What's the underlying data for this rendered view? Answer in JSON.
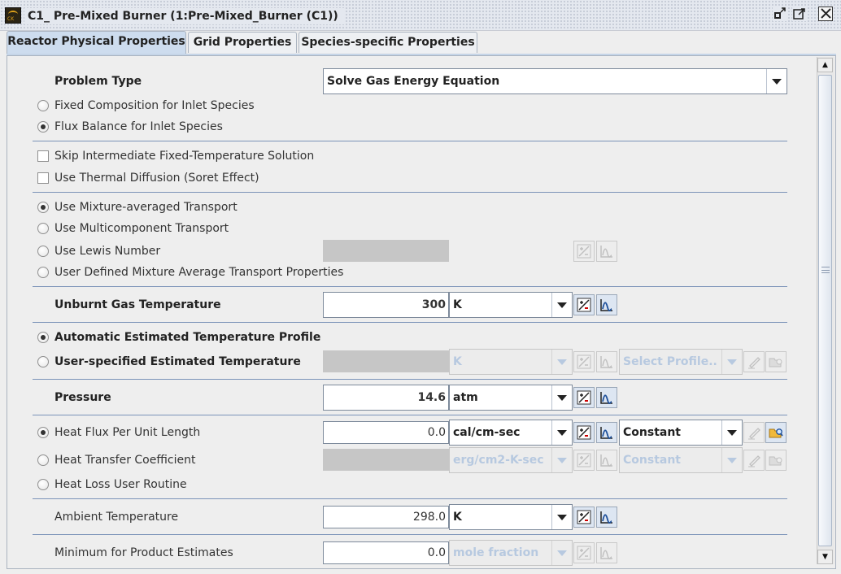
{
  "window": {
    "title": "C1_ Pre-Mixed Burner  (1:Pre-Mixed_Burner (C1))",
    "buttons": [
      "restore",
      "maximize",
      "close"
    ]
  },
  "tabs": [
    {
      "label": "Reactor Physical Properties",
      "active": true
    },
    {
      "label": "Grid Properties",
      "active": false
    },
    {
      "label": "Species-specific Properties",
      "active": false
    }
  ],
  "problem_type": {
    "label": "Problem Type",
    "value": "Solve Gas Energy Equation",
    "options": [
      {
        "label": "Fixed Composition for Inlet Species",
        "selected": false
      },
      {
        "label": "Flux Balance for Inlet Species",
        "selected": true
      }
    ]
  },
  "checkboxes": [
    {
      "label": "Skip Intermediate Fixed-Temperature Solution",
      "checked": false
    },
    {
      "label": "Use Thermal Diffusion (Soret Effect)",
      "checked": false
    }
  ],
  "transport": [
    {
      "label": "Use Mixture-averaged Transport",
      "selected": true
    },
    {
      "label": "Use Multicomponent Transport",
      "selected": false
    },
    {
      "label": "Use Lewis Number",
      "selected": false
    },
    {
      "label": "User Defined Mixture Average Transport Properties",
      "selected": false
    }
  ],
  "unburnt_gas": {
    "label": "Unburnt Gas Temperature",
    "value": "300",
    "unit": "K"
  },
  "temperature_profile": [
    {
      "label": "Automatic Estimated Temperature Profile",
      "selected": true
    },
    {
      "label": "User-specified Estimated Temperature",
      "selected": false,
      "unit": "K",
      "profile": "Select Profile.."
    }
  ],
  "pressure": {
    "label": "Pressure",
    "value": "14.6",
    "unit": "atm"
  },
  "heat_loss": [
    {
      "label": "Heat Flux Per Unit Length",
      "selected": true,
      "value": "0.0",
      "unit": "cal/cm-sec",
      "profile": "Constant"
    },
    {
      "label": "Heat Transfer Coefficient",
      "selected": false,
      "unit": "erg/cm2-K-sec",
      "profile": "Constant"
    },
    {
      "label": "Heat Loss User Routine",
      "selected": false
    }
  ],
  "ambient": {
    "label": "Ambient Temperature",
    "value": "298.0",
    "unit": "K"
  },
  "min_product": {
    "label": "Minimum for Product Estimates",
    "value": "0.0",
    "unit": "mole fraction"
  },
  "colors": {
    "active_tab": "#cddcee",
    "separator": "#7b93b8",
    "disabled_text": "#b7c9e0",
    "disabled_field": "#c6c6c6"
  }
}
